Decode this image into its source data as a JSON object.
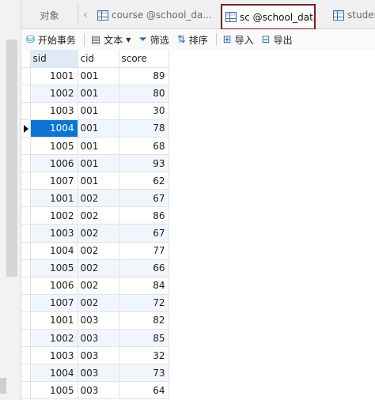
{
  "tabs": {
    "objects_label": "对象",
    "course_label": "course @school_da...",
    "sc_label": "sc @school_data (...",
    "student_label": "studen"
  },
  "toolbar": {
    "begin_transaction": "开始事务",
    "text": "文本",
    "filter": "筛选",
    "sort": "排序",
    "import": "导入",
    "export": "导出"
  },
  "grid": {
    "columns": [
      "sid",
      "cid",
      "score"
    ],
    "selected_row_index": 3,
    "rows": [
      {
        "sid": "1001",
        "cid": "001",
        "score": "89"
      },
      {
        "sid": "1002",
        "cid": "001",
        "score": "80"
      },
      {
        "sid": "1003",
        "cid": "001",
        "score": "30"
      },
      {
        "sid": "1004",
        "cid": "001",
        "score": "78"
      },
      {
        "sid": "1005",
        "cid": "001",
        "score": "68"
      },
      {
        "sid": "1006",
        "cid": "001",
        "score": "93"
      },
      {
        "sid": "1007",
        "cid": "001",
        "score": "62"
      },
      {
        "sid": "1001",
        "cid": "002",
        "score": "67"
      },
      {
        "sid": "1002",
        "cid": "002",
        "score": "86"
      },
      {
        "sid": "1003",
        "cid": "002",
        "score": "67"
      },
      {
        "sid": "1004",
        "cid": "002",
        "score": "77"
      },
      {
        "sid": "1005",
        "cid": "002",
        "score": "66"
      },
      {
        "sid": "1006",
        "cid": "002",
        "score": "84"
      },
      {
        "sid": "1007",
        "cid": "002",
        "score": "72"
      },
      {
        "sid": "1001",
        "cid": "003",
        "score": "82"
      },
      {
        "sid": "1002",
        "cid": "003",
        "score": "85"
      },
      {
        "sid": "1003",
        "cid": "003",
        "score": "32"
      },
      {
        "sid": "1004",
        "cid": "003",
        "score": "73"
      },
      {
        "sid": "1005",
        "cid": "003",
        "score": "64"
      }
    ]
  },
  "colors": {
    "selected_cell": "#0a75d7",
    "active_tab_outline": "#7b1c22",
    "alt_row": "#f1f6fc"
  }
}
